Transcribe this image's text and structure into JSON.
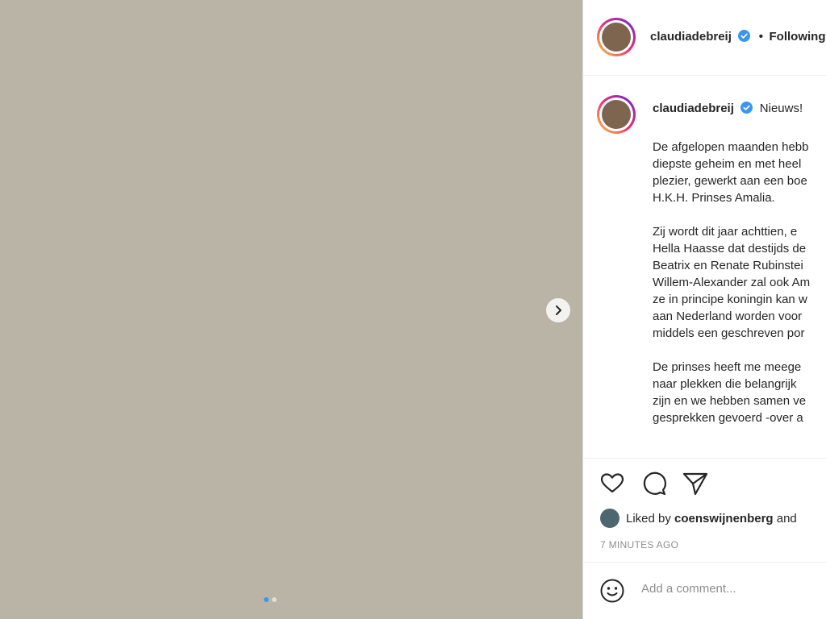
{
  "post": {
    "carousel": {
      "active_index": 0,
      "count": 2
    }
  },
  "header": {
    "username": "claudiadebreij",
    "separator": "•",
    "follow_label": "Following"
  },
  "caption": {
    "username": "claudiadebreij",
    "headline": "Nieuws!",
    "paragraphs": [
      [
        "De afgelopen maanden hebb",
        "diepste geheim en met heel",
        "plezier, gewerkt aan een boe",
        "H.K.H. Prinses Amalia."
      ],
      [
        "Zij wordt dit jaar achttien, e",
        "Hella Haasse dat destijds de",
        "Beatrix en Renate Rubinstei",
        "Willem-Alexander zal ook Am",
        "ze in principe koningin kan w",
        "aan Nederland worden voor",
        "middels een geschreven por"
      ],
      [
        "De prinses heeft me meege",
        "naar plekken die belangrijk",
        "zijn en we hebben samen ve",
        "gesprekken gevoerd -over a"
      ]
    ]
  },
  "likes": {
    "prefix": "Liked by",
    "user": "coenswijnenberg",
    "suffix": "and"
  },
  "timestamp": "7 MINUTES AGO",
  "comment": {
    "placeholder": "Add a comment..."
  },
  "colors": {
    "accent": "#3897f0",
    "muted": "#8e8e8e",
    "text": "#262626",
    "border": "#dbdbdb"
  },
  "icons": [
    "chevron-right-icon",
    "verified-badge-icon",
    "heart-icon",
    "comment-icon",
    "share-icon",
    "emoji-icon"
  ]
}
